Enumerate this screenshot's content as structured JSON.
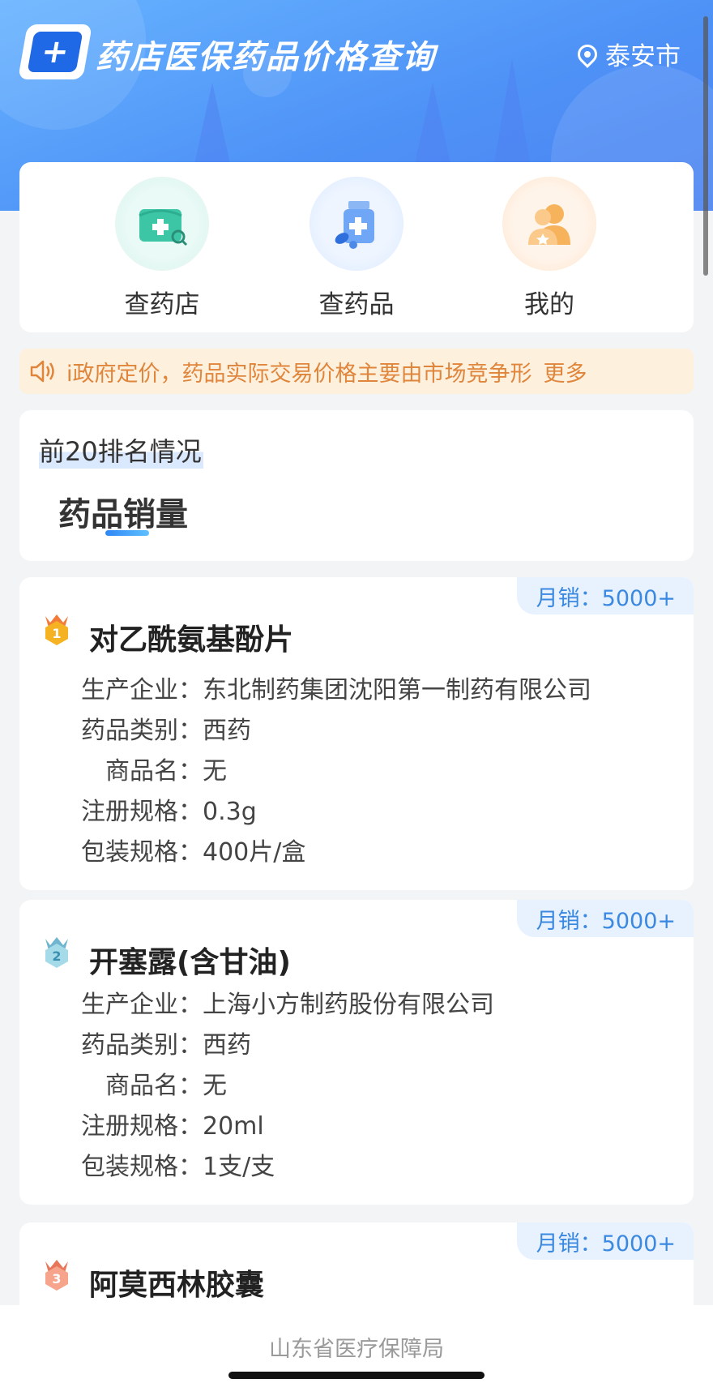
{
  "header": {
    "logo_text": "+",
    "title": "药店医保药品价格查询",
    "location": "泰安市"
  },
  "quick_actions": [
    {
      "label": "查药店",
      "icon": "pharmacy-icon"
    },
    {
      "label": "查药品",
      "icon": "medicine-bottle-icon"
    },
    {
      "label": "我的",
      "icon": "user-icon"
    }
  ],
  "notice": {
    "icon": "speaker-icon",
    "text": "i政府定价，药品实际交易价格主要由市场竞争形",
    "more": "更多"
  },
  "ranking": {
    "title": "前20排名情况",
    "active_tab": "药品销量"
  },
  "drug_fields": {
    "manufacturer": "生产企业：",
    "category": "药品类别：",
    "trade_name": "商品名：",
    "reg_spec": "注册规格：",
    "pack_spec": "包装规格："
  },
  "drugs": [
    {
      "rank": "1",
      "monthly_sales": "月销：5000+",
      "name": "对乙酰氨基酚片",
      "manufacturer": "东北制药集团沈阳第一制药有限公司",
      "category": "西药",
      "trade_name": "无",
      "reg_spec": "0.3g",
      "pack_spec": "400片/盒"
    },
    {
      "rank": "2",
      "monthly_sales": "月销：5000+",
      "name": "开塞露(含甘油)",
      "manufacturer": "上海小方制药股份有限公司",
      "category": "西药",
      "trade_name": "无",
      "reg_spec": "20ml",
      "pack_spec": "1支/支"
    },
    {
      "rank": "3",
      "monthly_sales": "月销：5000+",
      "name": "阿莫西林胶囊"
    }
  ],
  "footer": {
    "text": "山东省医疗保障局"
  },
  "colors": {
    "brand_blue": "#4f93f7",
    "notice_bg": "#fdf1de",
    "notice_text": "#e0853c",
    "gold": "#f5a623",
    "silver": "#7fc4d9",
    "bronze": "#f08b6a"
  }
}
